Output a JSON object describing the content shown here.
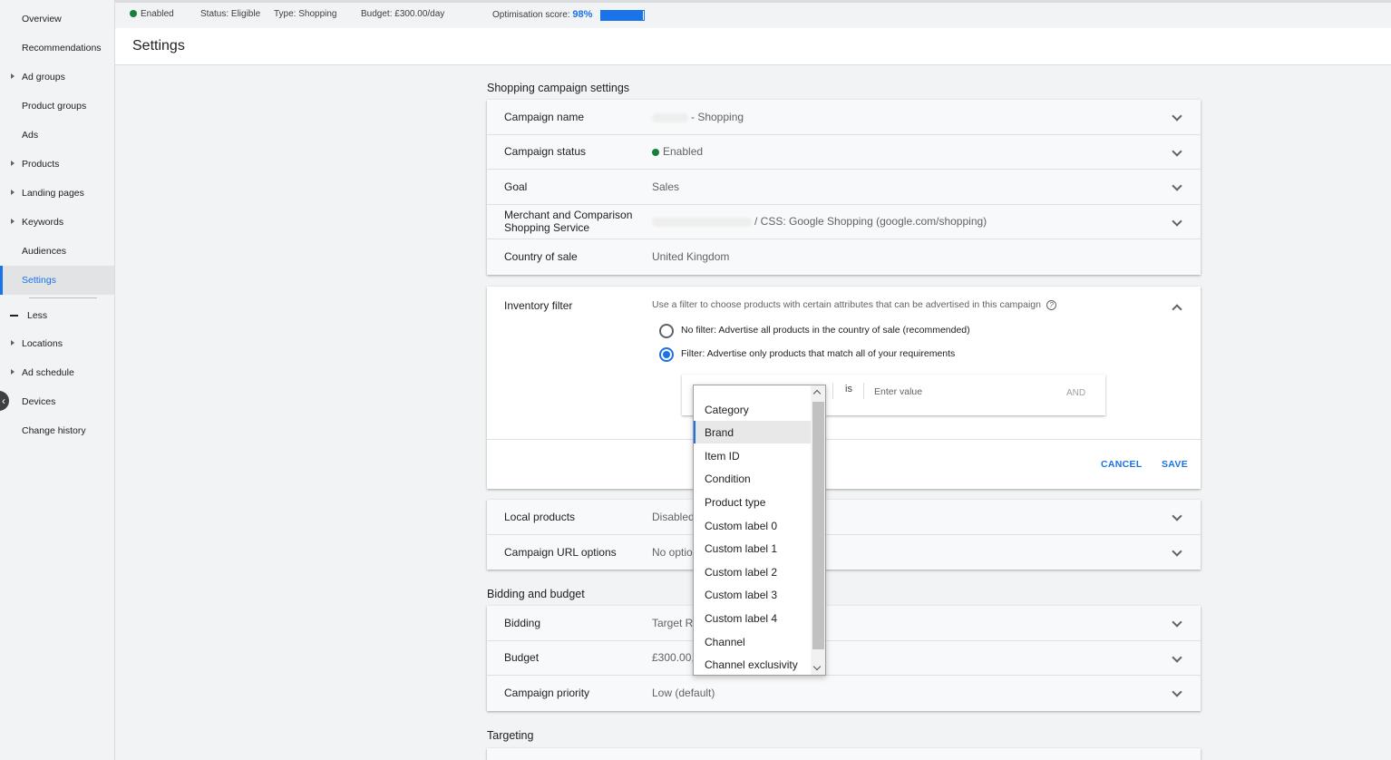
{
  "sidebar": {
    "items": [
      {
        "label": "Overview",
        "caret": false
      },
      {
        "label": "Recommendations",
        "caret": false
      },
      {
        "label": "Ad groups",
        "caret": true
      },
      {
        "label": "Product groups",
        "caret": false
      },
      {
        "label": "Ads",
        "caret": false
      },
      {
        "label": "Products",
        "caret": true
      },
      {
        "label": "Landing pages",
        "caret": true
      },
      {
        "label": "Keywords",
        "caret": true
      },
      {
        "label": "Audiences",
        "caret": false
      },
      {
        "label": "Settings",
        "caret": false,
        "active": true
      }
    ],
    "less_label": "Less",
    "more_items": [
      {
        "label": "Locations",
        "caret": true
      },
      {
        "label": "Ad schedule",
        "caret": true
      },
      {
        "label": "Devices",
        "caret": false
      },
      {
        "label": "Change history",
        "caret": false
      }
    ]
  },
  "statusbar": {
    "enabled": "Enabled",
    "status": "Status: Eligible",
    "type": "Type: Shopping",
    "budget": "Budget: £300.00/day",
    "optimisation_label": "Optimisation score:",
    "optimisation_value": "98%",
    "optimisation_fraction": 0.98
  },
  "header": {
    "title": "Settings"
  },
  "shopping_settings": {
    "title": "Shopping campaign settings",
    "rows": [
      {
        "label": "Campaign name",
        "value": "- Shopping"
      },
      {
        "label": "Campaign status",
        "value": "Enabled"
      },
      {
        "label": "Goal",
        "value": "Sales"
      },
      {
        "label": "Merchant and Comparison Shopping Service",
        "value": "/ CSS: Google Shopping (google.com/shopping)"
      },
      {
        "label": "Country of sale",
        "value": "United Kingdom"
      }
    ]
  },
  "inventory_filter": {
    "label": "Inventory filter",
    "description": "Use a filter to choose products with certain attributes that can be advertised in this campaign",
    "option_no_filter": "No filter: Advertise all products in the country of sale (recommended)",
    "option_filter": "Filter: Advertise only products that match all of your requirements",
    "operator": "is",
    "value_placeholder": "Enter value",
    "and_label": "AND",
    "cancel_label": "CANCEL",
    "save_label": "SAVE"
  },
  "attribute_dropdown": {
    "options": [
      "Category",
      "Brand",
      "Item ID",
      "Condition",
      "Product type",
      "Custom label 0",
      "Custom label 1",
      "Custom label 2",
      "Custom label 3",
      "Custom label 4",
      "Channel",
      "Channel exclusivity"
    ],
    "highlighted": "Brand"
  },
  "local_settings": {
    "rows": [
      {
        "label": "Local products",
        "value": "Disabled"
      },
      {
        "label": "Campaign URL options",
        "value": "No optio"
      }
    ]
  },
  "bidding": {
    "title": "Bidding and budget",
    "rows": [
      {
        "label": "Bidding",
        "value": "Target R"
      },
      {
        "label": "Budget",
        "value": "£300.00,"
      },
      {
        "label": "Campaign priority",
        "value": "Low (default)"
      }
    ]
  },
  "targeting": {
    "title": "Targeting"
  },
  "colors": {
    "accent": "#1a73e8",
    "enabled_green": "#188038"
  }
}
